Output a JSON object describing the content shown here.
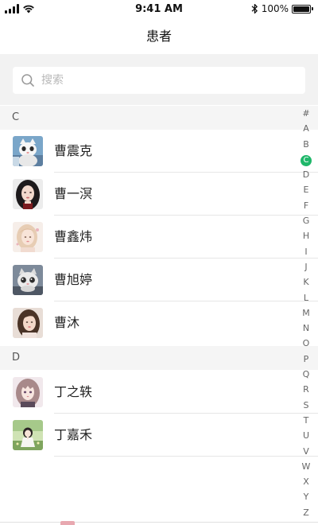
{
  "status_bar": {
    "time": "9:41 AM",
    "battery": "100%"
  },
  "nav": {
    "title": "患者"
  },
  "search": {
    "placeholder": "搜索"
  },
  "sections": [
    {
      "letter": "C",
      "patients": [
        {
          "name": "曹震克",
          "avatar": "avatar-cat"
        },
        {
          "name": "曹一溟",
          "avatar": "avatar-girl-dark-hair"
        },
        {
          "name": "曹鑫炜",
          "avatar": "avatar-girl-light"
        },
        {
          "name": "曹旭婷",
          "avatar": "avatar-kitten"
        },
        {
          "name": "曹沐",
          "avatar": "avatar-girl-photo"
        }
      ]
    },
    {
      "letter": "D",
      "patients": [
        {
          "name": "丁之轶",
          "avatar": "avatar-anime-girl"
        },
        {
          "name": "丁嘉禾",
          "avatar": "avatar-anime-field"
        }
      ]
    }
  ],
  "index": [
    "#",
    "A",
    "B",
    "C",
    "D",
    "E",
    "F",
    "G",
    "H",
    "I",
    "J",
    "K",
    "L",
    "M",
    "N",
    "O",
    "P",
    "Q",
    "R",
    "S",
    "T",
    "U",
    "V",
    "W",
    "X",
    "Y",
    "Z"
  ],
  "index_active": "C",
  "colors": {
    "accent": "#1fb76a",
    "section_bg": "#f5f5f5",
    "search_bg": "#f2f2f2"
  }
}
